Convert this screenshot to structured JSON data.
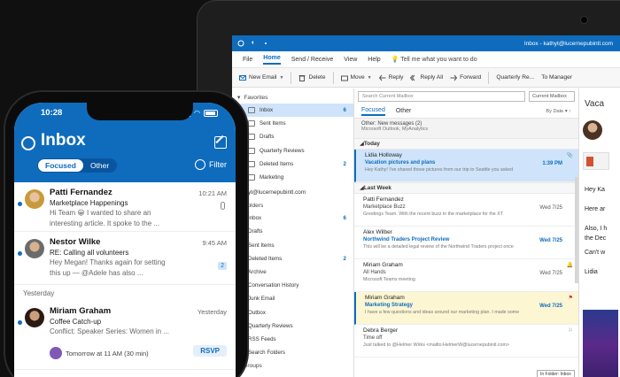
{
  "laptop": {
    "titlebar": {
      "title": "Inbox - kathyt@lucernepubintl.com"
    },
    "menu": [
      "File",
      "Home",
      "Send / Receive",
      "View",
      "Help"
    ],
    "tell_me": "Tell me what you want to do",
    "ribbon": {
      "new_email": "New Email",
      "delete": "Delete",
      "move": "Move",
      "reply": "Reply",
      "reply_all": "Reply All",
      "forward": "Forward",
      "quick1": "Quarterly Re...",
      "quick2": "To Manager"
    },
    "folders": {
      "favorites_header": "Favorites",
      "favorites": [
        {
          "label": "Inbox",
          "count": "6"
        },
        {
          "label": "Sent Items",
          "count": ""
        },
        {
          "label": "Drafts",
          "count": ""
        },
        {
          "label": "Quarterly Reviews",
          "count": ""
        },
        {
          "label": "Deleted Items",
          "count": "2"
        },
        {
          "label": "Marketing",
          "count": ""
        }
      ],
      "account": "kathyt@lucernepubintl.com",
      "folders_header": "Folders",
      "items": [
        {
          "label": "Inbox",
          "count": "6"
        },
        {
          "label": "Drafts",
          "count": ""
        },
        {
          "label": "Sent Items",
          "count": ""
        },
        {
          "label": "Deleted Items",
          "count": "2"
        },
        {
          "label": "Archive",
          "count": ""
        },
        {
          "label": "Conversation History",
          "count": ""
        },
        {
          "label": "Junk Email",
          "count": ""
        },
        {
          "label": "Outbox",
          "count": ""
        },
        {
          "label": "Quarterly Reviews",
          "count": ""
        },
        {
          "label": "RSS Feeds",
          "count": ""
        },
        {
          "label": "Search Folders",
          "count": ""
        }
      ],
      "groups_header": "Groups"
    },
    "list": {
      "search_placeholder": "Search Current Mailbox",
      "scope": "Current Mailbox",
      "tab_focused": "Focused",
      "tab_other": "Other",
      "sort": "By Date",
      "other_title": "Other: New messages (2)",
      "other_sub": "Microsoft Outlook, MyAnalytics",
      "group_today": "Today",
      "group_lastweek": "Last Week",
      "messages_today": [
        {
          "from": "Lidia Holloway",
          "subject": "Vacation pictures and plans",
          "preview": "Hey Kathy! I've shared those pictures from our trip to Seattle you asked",
          "time": "1:39 PM"
        }
      ],
      "messages_lastweek": [
        {
          "from": "Patti Fernandez",
          "subject": "Marketplace Buzz",
          "preview": "Greetings Team. With the recent buzz in the marketplace for the XT",
          "time": "Wed 7/25"
        },
        {
          "from": "Alex Wilber",
          "subject": "Northwind Traders Project Review",
          "preview": "This will be a detailed legal review of the Northwind Traders project once",
          "time": "Wed 7/25"
        },
        {
          "from": "Miriam Graham",
          "subject": "All Hands",
          "preview": "Microsoft Teams meeting",
          "time": "Wed 7/25"
        },
        {
          "from": "Miriam Graham",
          "subject": "Marketing Strategy",
          "preview": "I have a few questions and ideas around our marketing plan. I made some",
          "time": "Wed 7/25"
        },
        {
          "from": "Debra Berger",
          "subject": "Time off",
          "preview": "Just talked to @Helmer Wirks <mailto:HelmerW@lucernepubintl.com>",
          "time": ""
        }
      ],
      "tooltip": "In Folder: Inbox"
    },
    "reading": {
      "subject": "Vaca",
      "lines": [
        "Hey Ka",
        "Here ar",
        "Also, I h",
        "the Dec",
        "Can't w",
        "Lidia"
      ]
    }
  },
  "phone": {
    "status_time": "10:28",
    "title": "Inbox",
    "tab_focused": "Focused",
    "tab_other": "Other",
    "filter": "Filter",
    "messages": [
      {
        "from": "Patti Fernandez",
        "subject": "Marketplace Happenings",
        "preview1": "Hi Team 😀 I wanted to share an",
        "preview2": "interesting article. It spoke to the ...",
        "time": "10:21 AM"
      },
      {
        "from": "Nestor Wilke",
        "subject": "RE: Calling all volunteers",
        "preview1": "Hey Megan! Thanks again for setting",
        "preview2": "this up — @Adele has also ...",
        "time": "9:45 AM",
        "badge": "2"
      }
    ],
    "section_yesterday": "Yesterday",
    "yesterday_messages": [
      {
        "from": "Miriam Graham",
        "subject": "Coffee Catch-up",
        "preview1": "Conflict: Speaker Series: Women in ...",
        "time": "Yesterday",
        "event": "Tomorrow at 11 AM (30 min)",
        "rsvp": "RSVP"
      }
    ]
  },
  "colors": {
    "accent": "#0f6cbd",
    "selected": "#cfe4fa",
    "flagged": "#fdf6d3"
  }
}
